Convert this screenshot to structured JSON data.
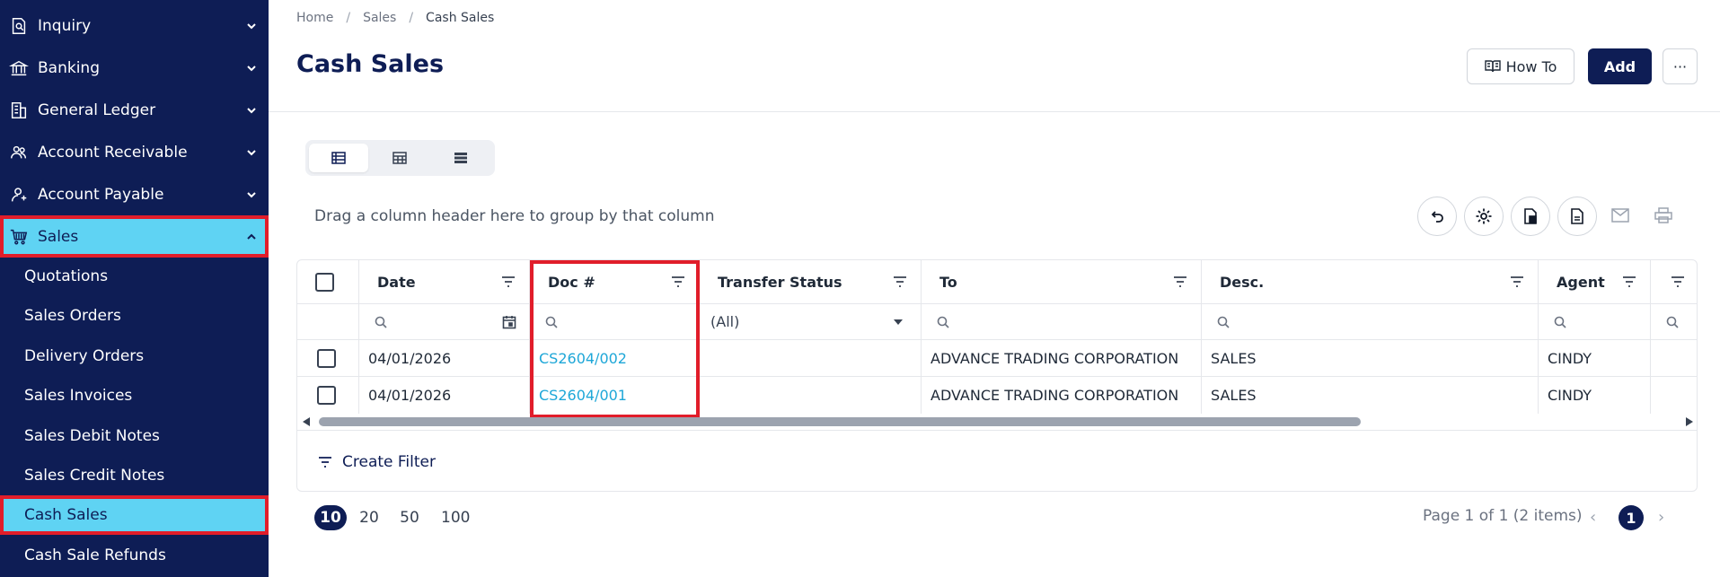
{
  "sidebar": {
    "items": [
      {
        "label": "Inquiry",
        "icon": "inquiry-icon"
      },
      {
        "label": "Banking",
        "icon": "bank-icon"
      },
      {
        "label": "General Ledger",
        "icon": "ledger-icon"
      },
      {
        "label": "Account Receivable",
        "icon": "receivable-icon"
      },
      {
        "label": "Account Payable",
        "icon": "payable-icon"
      },
      {
        "label": "Sales",
        "icon": "cart-icon"
      }
    ],
    "sales_sub": [
      "Quotations",
      "Sales Orders",
      "Delivery Orders",
      "Sales Invoices",
      "Sales Debit Notes",
      "Sales Credit Notes",
      "Cash Sales",
      "Cash Sale Refunds"
    ]
  },
  "breadcrumb": {
    "home": "Home",
    "sales": "Sales",
    "current": "Cash Sales",
    "sep": "/"
  },
  "header": {
    "title": "Cash Sales",
    "howto_label": "How To",
    "add_label": "Add",
    "more_label": "···"
  },
  "group_hint": "Drag a column header here to group by that column",
  "grid": {
    "columns": [
      "Date",
      "Doc #",
      "Transfer Status",
      "To",
      "Desc.",
      "Agent"
    ],
    "transfer_filter_value": "(All)",
    "rows": [
      {
        "date": "04/01/2026",
        "doc": "CS2604/002",
        "status": "",
        "to": "ADVANCE TRADING CORPORATION",
        "desc": "SALES",
        "agent": "CINDY"
      },
      {
        "date": "04/01/2026",
        "doc": "CS2604/001",
        "status": "",
        "to": "ADVANCE TRADING CORPORATION",
        "desc": "SALES",
        "agent": "CINDY"
      }
    ],
    "create_filter_label": "Create Filter"
  },
  "pager": {
    "sizes": [
      "10",
      "20",
      "50",
      "100"
    ],
    "selected_size": "10",
    "info": "Page 1 of 1 (2 items)",
    "current_page": "1"
  },
  "colors": {
    "sidebar_bg": "#0e1d55",
    "active_bg": "#5fd3f3",
    "link": "#1ea7d8",
    "highlight": "#e11d2a"
  }
}
